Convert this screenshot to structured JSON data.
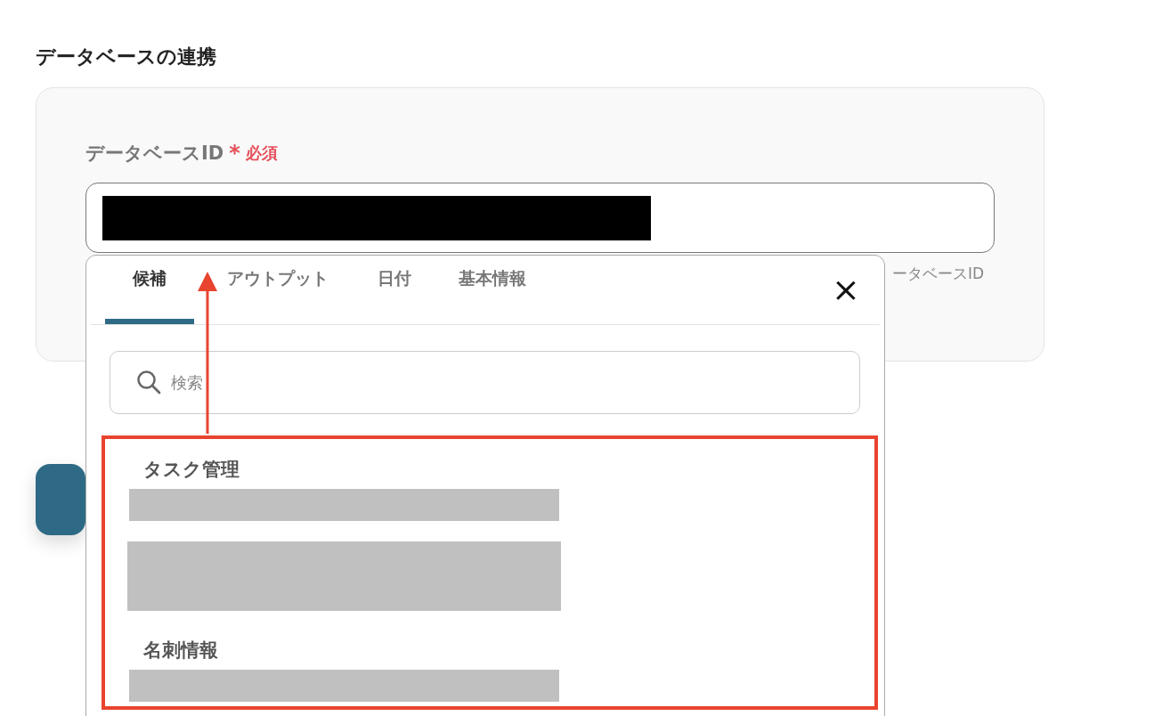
{
  "heading": "データベースの連携",
  "field": {
    "label": "データベースID",
    "required_mark": "*",
    "required_label": "必須",
    "value_redacted": true,
    "hint": "ータベースID"
  },
  "popup": {
    "tabs": [
      {
        "label": "候補",
        "selected": true
      },
      {
        "label": "アウトプット",
        "selected": false
      },
      {
        "label": "日付",
        "selected": false
      },
      {
        "label": "基本情報",
        "selected": false
      }
    ],
    "close": "×",
    "search": {
      "placeholder": "検索"
    },
    "groups": [
      {
        "title": "タスク管理",
        "items": [
          {
            "kind": "short"
          },
          {
            "kind": "tall"
          }
        ]
      },
      {
        "title": "名刺情報",
        "items": [
          {
            "kind": "short"
          }
        ]
      }
    ]
  }
}
